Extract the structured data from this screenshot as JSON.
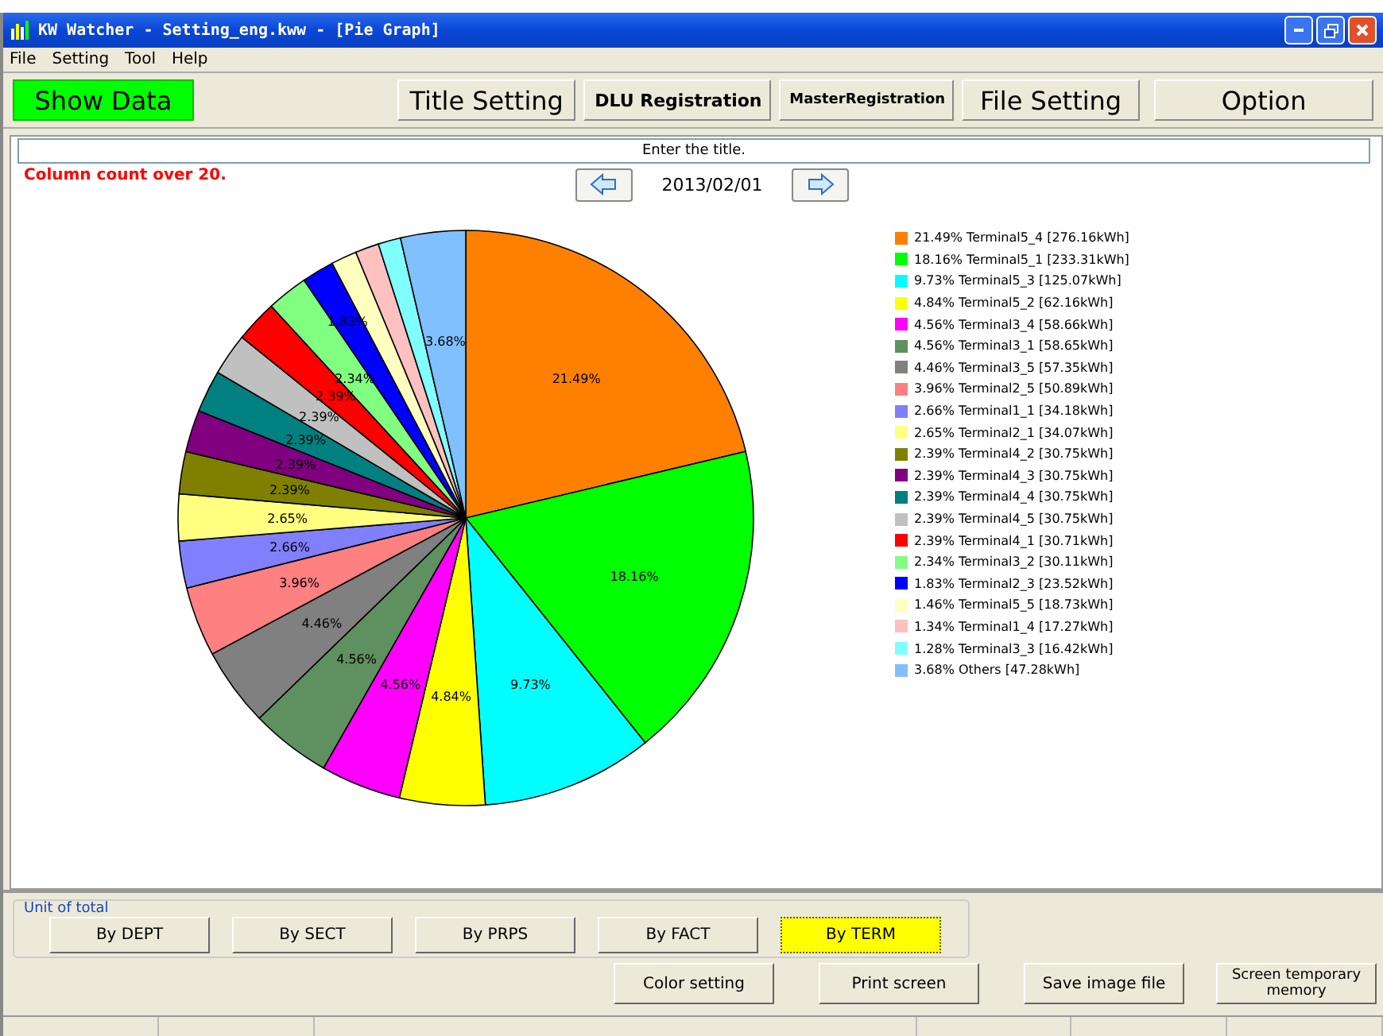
{
  "window": {
    "title": "KW Watcher - Setting_eng.kww - [Pie Graph]"
  },
  "menu": [
    "File",
    "Setting",
    "Tool",
    "Help"
  ],
  "toolbar": [
    {
      "label": "Show Data",
      "highlighted": true
    },
    {
      "label": "Title Setting",
      "highlighted": false
    },
    {
      "label": "DLU Registration",
      "highlighted": false
    },
    {
      "label": "MasterRegistration",
      "highlighted": false
    },
    {
      "label": "File Setting",
      "highlighted": false
    },
    {
      "label": "Option",
      "highlighted": false
    }
  ],
  "title_field": {
    "value": "Enter the title."
  },
  "warning": "Column count over 20.",
  "date": "2013/02/01",
  "chart": {
    "chart_data": {
      "type": "pie",
      "values": [
        21.49,
        18.16,
        9.73,
        4.84,
        4.56,
        4.56,
        4.46,
        3.96,
        2.66,
        2.65,
        2.39,
        2.39,
        2.39,
        2.39,
        2.39,
        2.34,
        1.83,
        1.46,
        1.34,
        1.28,
        3.68
      ],
      "value_labels": [
        "21.49%",
        "18.16%",
        "9.73%",
        "4.84%",
        "4.56%",
        "4.56%",
        "4.46%",
        "3.96%",
        "2.66%",
        "2.65%",
        "2.39%",
        "2.39%",
        "2.39%",
        "2.39%",
        "2.39%",
        "2.34%",
        "1.83%",
        null,
        null,
        null,
        "3.68%"
      ]
    },
    "legend": [
      {
        "text": "21.49% Terminal5_4 [276.16kWh]",
        "color": "#ff8000"
      },
      {
        "text": "18.16% Terminal5_1 [233.31kWh]",
        "color": "#00ff00"
      },
      {
        "text": "9.73% Terminal5_3 [125.07kWh]",
        "color": "#00ffff"
      },
      {
        "text": "4.84% Terminal5_2 [62.16kWh]",
        "color": "#ffff00"
      },
      {
        "text": "4.56% Terminal3_4 [58.66kWh]",
        "color": "#ff00ff"
      },
      {
        "text": "4.56% Terminal3_1 [58.65kWh]",
        "color": "#5f9060"
      },
      {
        "text": "4.46% Terminal3_5 [57.35kWh]",
        "color": "#808080"
      },
      {
        "text": "3.96% Terminal2_5 [50.89kWh]",
        "color": "#ff8080"
      },
      {
        "text": "2.66% Terminal1_1 [34.18kWh]",
        "color": "#8080ff"
      },
      {
        "text": "2.65% Terminal2_1 [34.07kWh]",
        "color": "#ffff80"
      },
      {
        "text": "2.39% Terminal4_2 [30.75kWh]",
        "color": "#808000"
      },
      {
        "text": "2.39% Terminal4_3 [30.75kWh]",
        "color": "#800080"
      },
      {
        "text": "2.39% Terminal4_4 [30.75kWh]",
        "color": "#008080"
      },
      {
        "text": "2.39% Terminal4_5 [30.75kWh]",
        "color": "#c0c0c0"
      },
      {
        "text": "2.39% Terminal4_1 [30.71kWh]",
        "color": "#ff0000"
      },
      {
        "text": "2.34% Terminal3_2 [30.11kWh]",
        "color": "#80ff80"
      },
      {
        "text": "1.83% Terminal2_3 [23.52kWh]",
        "color": "#0000ff"
      },
      {
        "text": "1.46% Terminal5_5 [18.73kWh]",
        "color": "#ffffc0"
      },
      {
        "text": "1.34% Terminal1_4 [17.27kWh]",
        "color": "#ffc0c0"
      },
      {
        "text": "1.28% Terminal3_3 [16.42kWh]",
        "color": "#80ffff"
      },
      {
        "text": "3.68% Others [47.28kWh]",
        "color": "#80c0ff"
      }
    ]
  },
  "unit_of_total": {
    "label": "Unit of total",
    "buttons": [
      {
        "label": "By DEPT",
        "selected": false
      },
      {
        "label": "By SECT",
        "selected": false
      },
      {
        "label": "By PRPS",
        "selected": false
      },
      {
        "label": "By FACT",
        "selected": false
      },
      {
        "label": "By TERM",
        "selected": true
      }
    ]
  },
  "actions": [
    "Color setting",
    "Print screen",
    "Save image file",
    "Screen temporary memory"
  ]
}
